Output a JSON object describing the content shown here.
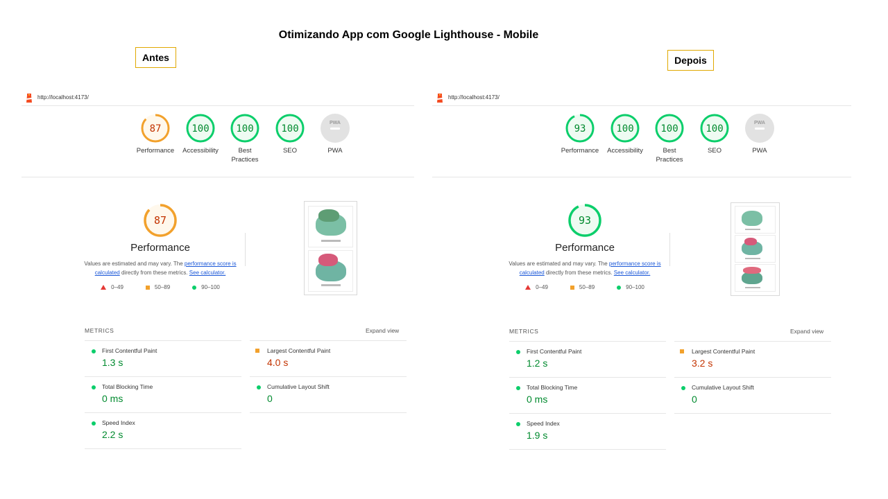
{
  "title": "Otimizando App com Google Lighthouse - Mobile",
  "labels": {
    "before": "Antes",
    "after": "Depois"
  },
  "colors": {
    "pass": "#0cce6b",
    "average": "#f2a12c",
    "fail": "#e53935",
    "pass_text": "#008a2e",
    "average_text": "#c33300"
  },
  "reports": {
    "before": {
      "url": "http://localhost:4173/",
      "gauges": [
        {
          "score": "87",
          "label": "Performance",
          "status": "average"
        },
        {
          "score": "100",
          "label": "Accessibility",
          "status": "pass"
        },
        {
          "score": "100",
          "label": "Best Practices",
          "status": "pass"
        },
        {
          "score": "100",
          "label": "SEO",
          "status": "pass"
        },
        {
          "score": "",
          "label": "PWA",
          "status": "na"
        }
      ],
      "performance": {
        "score": "87",
        "title": "Performance",
        "note_pre": "Values are estimated and may vary. The ",
        "note_link1": "performance score is calculated",
        "note_mid": " directly from these metrics. ",
        "note_link2": "See calculator."
      },
      "legend": {
        "fail": "0–49",
        "average": "50–89",
        "pass": "90–100"
      },
      "metrics_heading": "METRICS",
      "expand_label": "Expand view",
      "metrics": {
        "fcp": {
          "label": "First Contentful Paint",
          "value": "1.3 s"
        },
        "lcp": {
          "label": "Largest Contentful Paint",
          "value": "4.0 s"
        },
        "tbt": {
          "label": "Total Blocking Time",
          "value": "0 ms"
        },
        "cls": {
          "label": "Cumulative Layout Shift",
          "value": "0"
        },
        "si": {
          "label": "Speed Index",
          "value": "2.2 s"
        }
      }
    },
    "after": {
      "url": "http://localhost:4173/",
      "gauges": [
        {
          "score": "93",
          "label": "Performance",
          "status": "pass"
        },
        {
          "score": "100",
          "label": "Accessibility",
          "status": "pass"
        },
        {
          "score": "100",
          "label": "Best Practices",
          "status": "pass"
        },
        {
          "score": "100",
          "label": "SEO",
          "status": "pass"
        },
        {
          "score": "",
          "label": "PWA",
          "status": "na"
        }
      ],
      "performance": {
        "score": "93",
        "title": "Performance",
        "note_pre": "Values are estimated and may vary. The ",
        "note_link1": "performance score is calculated",
        "note_mid": " directly from these metrics. ",
        "note_link2": "See calculator."
      },
      "legend": {
        "fail": "0–49",
        "average": "50–89",
        "pass": "90–100"
      },
      "metrics_heading": "METRICS",
      "expand_label": "Expand view",
      "metrics": {
        "fcp": {
          "label": "First Contentful Paint",
          "value": "1.2 s"
        },
        "lcp": {
          "label": "Largest Contentful Paint",
          "value": "3.2 s"
        },
        "tbt": {
          "label": "Total Blocking Time",
          "value": "0 ms"
        },
        "cls": {
          "label": "Cumulative Layout Shift",
          "value": "0"
        },
        "si": {
          "label": "Speed Index",
          "value": "1.9 s"
        }
      }
    }
  }
}
